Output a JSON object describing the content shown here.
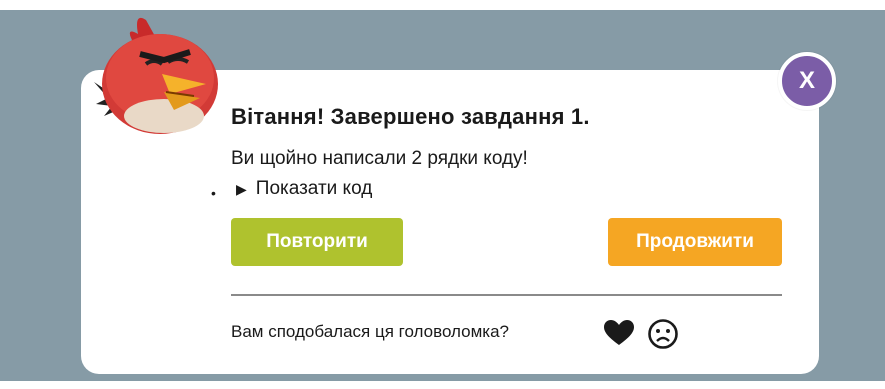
{
  "dialog": {
    "title": "Вітання! Завершено завдання 1.",
    "message": "Ви щойно написали 2 рядки коду!",
    "show_code_label": "Показати код",
    "bullet": "•",
    "close_label": "X",
    "retry_label": "Повторити",
    "continue_label": "Продовжити",
    "feedback_question": "Вам сподобалася ця головоломка?"
  },
  "colors": {
    "background": "#869ba6",
    "close_button": "#7b5da7",
    "retry_button": "#afc22e",
    "continue_button": "#f5a623"
  },
  "icons": {
    "character": "red-bird-icon",
    "close": "close-icon",
    "expand": "triangle-right-icon",
    "like": "heart-icon",
    "dislike": "sad-face-icon"
  }
}
